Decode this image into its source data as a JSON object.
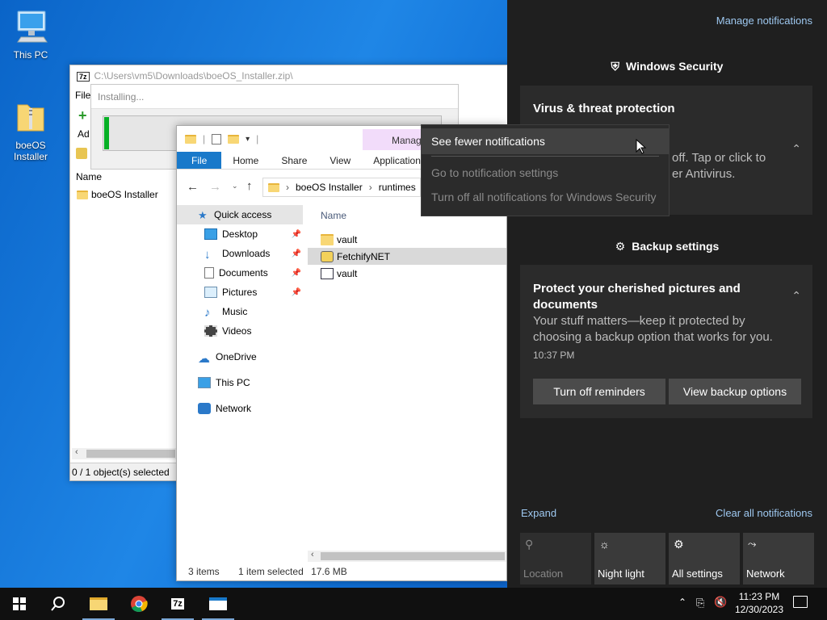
{
  "desktop": {
    "icons": [
      {
        "label": "This PC"
      },
      {
        "label": "boeOS\nInstaller"
      }
    ]
  },
  "sevenzip": {
    "title": "C:\\Users\\vm5\\Downloads\\boeOS_Installer.zip\\",
    "menu_file": "File",
    "add_label": "Ad",
    "column_name": "Name",
    "items": [
      "boeOS Installer"
    ],
    "status": "0 / 1 object(s) selected"
  },
  "installing": {
    "label": "Installing...",
    "progress": 0.01
  },
  "explorer": {
    "tabs": [
      "File",
      "Home",
      "Share",
      "View",
      "Application"
    ],
    "manage_tab": "Manag",
    "breadcrumb": [
      "boeOS Installer",
      "runtimes"
    ],
    "column_name": "Name",
    "nav": [
      {
        "label": "Quick access",
        "pinned": false
      },
      {
        "label": "Desktop",
        "pinned": true
      },
      {
        "label": "Downloads",
        "pinned": true
      },
      {
        "label": "Documents",
        "pinned": true
      },
      {
        "label": "Pictures",
        "pinned": true
      },
      {
        "label": "Music",
        "pinned": false
      },
      {
        "label": "Videos",
        "pinned": false
      },
      {
        "label": "OneDrive",
        "pinned": false
      },
      {
        "label": "This PC",
        "pinned": false
      },
      {
        "label": "Network",
        "pinned": false
      }
    ],
    "files": [
      {
        "name": "vault",
        "type": "folder"
      },
      {
        "name": "FetchifyNET",
        "type": "app"
      },
      {
        "name": "vault",
        "type": "file"
      }
    ],
    "status_items": "3 items",
    "status_selected": "1 item selected",
    "status_size": "17.6 MB"
  },
  "context_menu": {
    "items": [
      {
        "label": "See fewer notifications",
        "enabled": true
      },
      {
        "label": "Go to notification settings",
        "enabled": false
      },
      {
        "label": "Turn off all notifications for Windows Security",
        "enabled": false
      }
    ]
  },
  "action_center": {
    "manage_notifications": "Manage notifications",
    "group1": "Windows Security",
    "card1_title": "Virus & threat protection",
    "card1_body1": "off. Tap or click to",
    "card1_body2": "er Antivirus.",
    "group2": "Backup settings",
    "card2_title": "Protect your cherished pictures and documents",
    "card2_body": "Your stuff matters—keep it protected by choosing a backup option that works for you.",
    "card2_time": "10:37 PM",
    "btn_turn_off": "Turn off reminders",
    "btn_view_backup": "View backup options",
    "expand": "Expand",
    "clear_all": "Clear all notifications",
    "quick_actions": [
      {
        "label": "Location",
        "on": false
      },
      {
        "label": "Night light",
        "on": true
      },
      {
        "label": "All settings",
        "on": true
      },
      {
        "label": "Network",
        "on": true
      }
    ]
  },
  "taskbar": {
    "time": "11:23 PM",
    "date": "12/30/2023"
  },
  "colors": {
    "accent": "#1979ca",
    "link": "#9ec8f0",
    "progress": "#06b025"
  }
}
